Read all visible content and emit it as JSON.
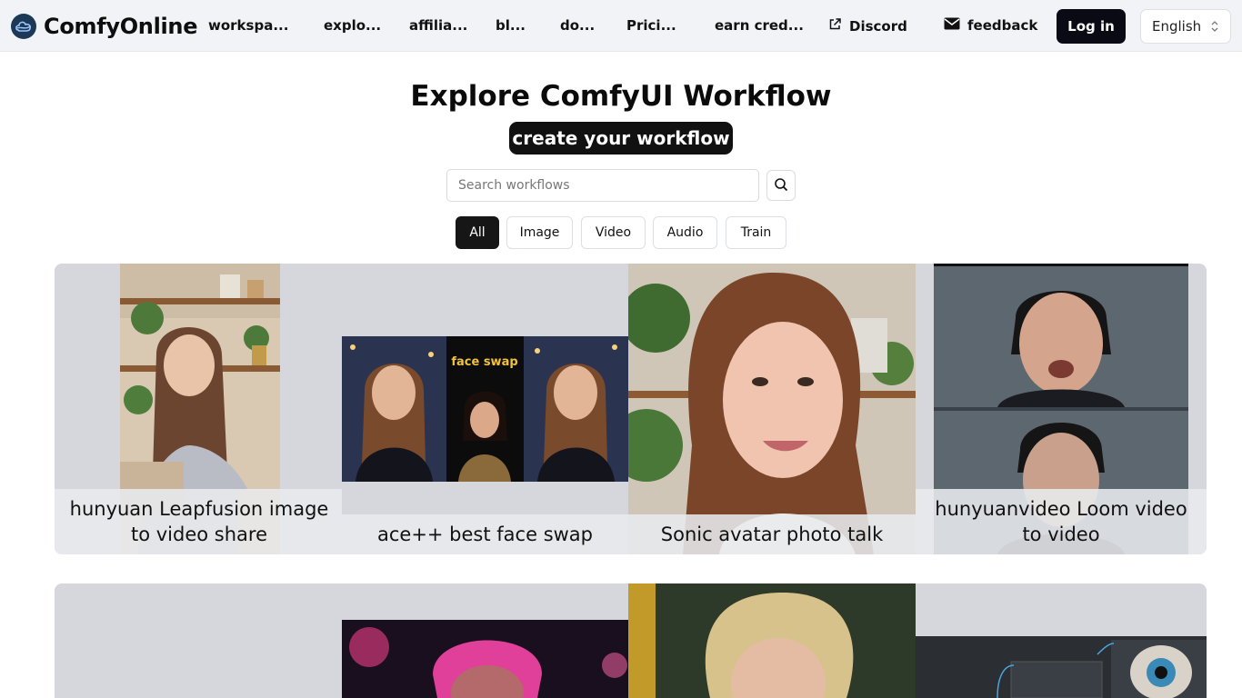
{
  "brand": {
    "name": "ComfyOnline"
  },
  "nav": {
    "items": [
      "workspa...",
      "explo...",
      "affilia...",
      "bl...",
      "do...",
      "Prici...",
      "earn cred..."
    ],
    "discord": "Discord",
    "feedback": "feedback",
    "login": "Log in",
    "language": "English"
  },
  "hero": {
    "title": "Explore ComfyUI Workflow",
    "create_label": "create your workflow",
    "search_placeholder": "Search workflows"
  },
  "filters": [
    "All",
    "Image",
    "Video",
    "Audio",
    "Train"
  ],
  "active_filter": "All",
  "cards": [
    {
      "title": "hunyuan Leapfusion image to video share"
    },
    {
      "title": "ace++ best face swap",
      "overlay_text": "face swap"
    },
    {
      "title": "Sonic avatar photo talk"
    },
    {
      "title": "hunyuanvideo Loom video to video"
    }
  ],
  "icons": {
    "logo": "cloud-logo-icon",
    "discord": "external-link-icon",
    "feedback": "envelope-icon",
    "search": "search-icon",
    "language": "chevron-updown-icon"
  },
  "colors": {
    "header_bg": "#f1f3f7",
    "primary_dark": "#111111",
    "card_placeholder": "#d5d7dd",
    "logo_bg": "#1c3a57"
  }
}
